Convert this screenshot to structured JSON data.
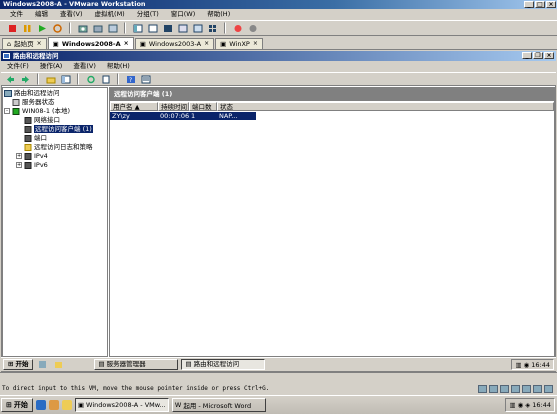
{
  "vm": {
    "title": "Windows2008-A - VMware Workstation",
    "menu": [
      "文件",
      "编辑",
      "查看(V)",
      "虚拟机(M)",
      "分组(T)",
      "窗口(W)",
      "帮助(H)"
    ],
    "tabs": [
      {
        "label": "起始页",
        "active": false
      },
      {
        "label": "Windows2008-A",
        "active": true
      },
      {
        "label": "Windows2003-A",
        "active": false
      },
      {
        "label": "WinXP",
        "active": false
      }
    ],
    "status_message": "To direct input to this VM, move the mouse pointer inside or press Ctrl+G."
  },
  "guest_window": {
    "title": "路由和远程访问",
    "menu": [
      "文件(F)",
      "操作(A)",
      "查看(V)",
      "帮助(H)"
    ]
  },
  "tree": {
    "nodes": [
      {
        "label": "路由和远程访问",
        "expander": "",
        "selected": false
      },
      {
        "label": "服务器状态",
        "expander": "",
        "selected": false
      },
      {
        "label": "WIN08-1 (本地)",
        "expander": "-",
        "selected": false
      },
      {
        "label": "网络接口",
        "expander": "",
        "selected": false
      },
      {
        "label": "远程访问客户端 (1)",
        "expander": "",
        "selected": true
      },
      {
        "label": "端口",
        "expander": "",
        "selected": false
      },
      {
        "label": "远程访问日志和策略",
        "expander": "",
        "selected": false
      },
      {
        "label": "IPv4",
        "expander": "+",
        "selected": false
      },
      {
        "label": "IPv6",
        "expander": "+",
        "selected": false
      }
    ]
  },
  "list": {
    "header": "远程访问客户端 (1)",
    "columns": [
      "用户名 ▲",
      "持续时间",
      "端口数",
      "状态"
    ],
    "rows": [
      {
        "user": "ZY\\zy",
        "duration": "00:07:06",
        "ports": "1",
        "status": "NAP..."
      }
    ]
  },
  "guest_taskbar": {
    "start": "开始",
    "tasks": [
      {
        "label": "服务器管理器",
        "pressed": false
      },
      {
        "label": "路由和远程访问",
        "pressed": true
      }
    ],
    "clock": "16:44"
  },
  "host_taskbar": {
    "start": "开始",
    "tasks": [
      {
        "label": "Windows2008-A - VMw...",
        "pressed": true
      },
      {
        "label": "起用 - Microsoft Word",
        "pressed": false
      }
    ],
    "clock": "16:44"
  },
  "colors": {
    "title_active": "#0a246a",
    "selection": "#0a246a",
    "face": "#d4d0c8"
  }
}
